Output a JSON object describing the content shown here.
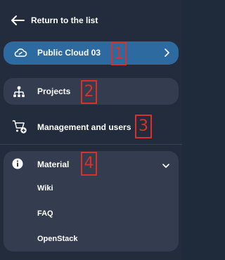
{
  "return_link": {
    "label": "Return to the list"
  },
  "nav": {
    "cloud": {
      "label": "Public Cloud 03"
    },
    "projects": {
      "label": "Projects"
    },
    "management": {
      "label": "Management and users"
    },
    "material": {
      "label": "Material",
      "items": [
        "Wiki",
        "FAQ",
        "OpenStack"
      ]
    }
  },
  "annotations": [
    "1",
    "2",
    "3",
    "4"
  ],
  "colors": {
    "background": "#222c3c",
    "active": "#2d6aa0",
    "hover": "#343d50",
    "annotation": "#d9302b"
  }
}
